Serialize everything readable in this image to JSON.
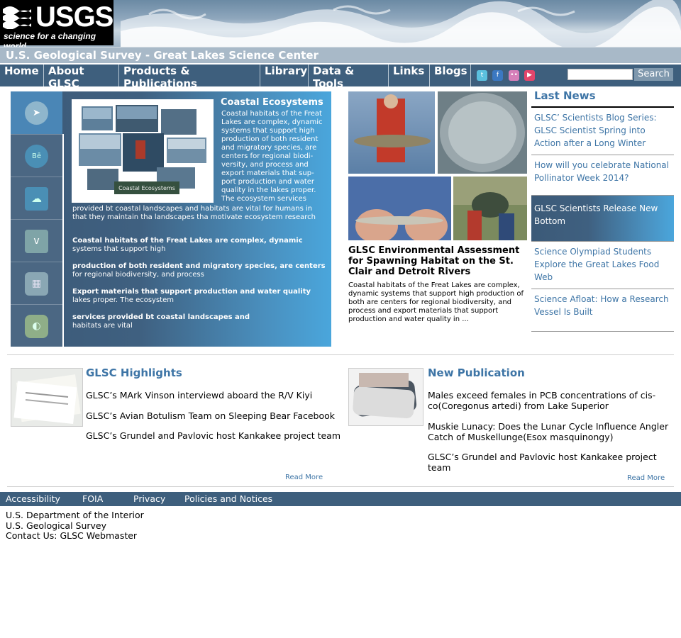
{
  "logo": {
    "text": "USGS",
    "tagline": "science for a changing world"
  },
  "site_title": "U.S. Geological Survey - Great Lakes Science Center",
  "nav": {
    "items": [
      "Home",
      "About GLSC",
      "Products & Publications",
      "Library",
      "Data & Tools",
      "Links",
      "Blogs"
    ],
    "social": [
      {
        "icon": "twitter-icon",
        "glyph": "t",
        "color": "#5bc0de"
      },
      {
        "icon": "facebook-icon",
        "glyph": "f",
        "color": "#3b78c2"
      },
      {
        "icon": "flickr-icon",
        "glyph": "••",
        "color": "#d67fb9"
      },
      {
        "icon": "youtube-icon",
        "glyph": "▶",
        "color": "#e2456b"
      }
    ],
    "search_placeholder": "",
    "search_label": "Search"
  },
  "feature": {
    "title": "Coastal Ecosystems",
    "image_caption": "Coastal Ecosystems",
    "text_main": "Coastal habitats of the Freat Lakes are complex, dynamic systems that support high production of both resident and migratory species, are centers for regional biodi-versity, and process and export materials that sup-port production and water quality in the lakes proper. The ecosystem services",
    "text_continued": "provided bt coastal landscapes and habitats are vital for humans in that they maintain tha landscapes tha motivate ecosystem research",
    "list": [
      {
        "bold": "Coastal habitats of the Freat Lakes are complex, dynamic",
        "normal": "systems that support high"
      },
      {
        "bold": "production of both resident and migratory species, are centers",
        "normal": "for regional biodiversity, and process"
      },
      {
        "bold": "Export materials that support production and water quality",
        "normal": "lakes proper. The ecosystem"
      },
      {
        "bold": "services provided bt coastal landscapes and",
        "normal": "habitats are vital"
      }
    ],
    "side_icons": [
      {
        "icon": "cursor-icon",
        "glyph": "➤",
        "color": "#8fb6cc"
      },
      {
        "icon": "behance-icon",
        "glyph": "Bē",
        "color": "#4a8fb5"
      },
      {
        "icon": "cloud-icon",
        "glyph": "☁",
        "color": "#4a8fb5"
      },
      {
        "icon": "vimeo-icon",
        "glyph": "v",
        "color": "#7fa4a7"
      },
      {
        "icon": "grid-icon",
        "glyph": "▦",
        "color": "#8aa7b4"
      },
      {
        "icon": "leaf-icon",
        "glyph": "◐",
        "color": "#8fae88"
      }
    ]
  },
  "middle": {
    "title": "GLSC Environmental Assessment for Spawning Habitat on the St. Clair and Detroit Rivers",
    "text": "Coastal habitats of the Freat Lakes are complex, dynamic systems that support high production of both are centers for regional biodiversity, and process and export materials that support production and water quality in ..."
  },
  "news": {
    "title": "Last News",
    "items": [
      "GLSC’ Scientists Blog Series: GLSC Scientist Spring into Action after a Long Winter",
      "How will you celebrate National Pollinator Week 2014?",
      "GLSC Scientists Release New Bottom",
      "Science Olympiad Students Explore the Great Lakes Food Web",
      "Science Afloat: How a Research Vessel Is Built"
    ]
  },
  "highlights": {
    "title": "GLSC Highlights",
    "items": [
      "GLSC’s MArk Vinson interviewd aboard the R/V Kiyi",
      "GLSC’s Avian Botulism Team on Sleeping Bear Facebook",
      "GLSC’s Grundel and Pavlovic host Kankakee project team"
    ],
    "read_more": "Read More"
  },
  "publication": {
    "title": "New Publication",
    "items": [
      "Males exceed females in PCB concentrations of cis-co(Coregonus artedi) from Lake Superior",
      "Muskie Lunacy: Does the Lunar Cycle Influence Angler Catch of Muskellunge(Esox masquinongy)",
      "GLSC’s Grundel and Pavlovic host Kankakee project team"
    ],
    "read_more": "Read More"
  },
  "footer": {
    "links": [
      "Accessibility",
      "FOIA",
      "Privacy",
      "Policies and Notices"
    ],
    "lines": [
      "U.S. Department of the Interior",
      "U.S. Geological Survey",
      "Contact Us: GLSC Webmaster"
    ]
  }
}
